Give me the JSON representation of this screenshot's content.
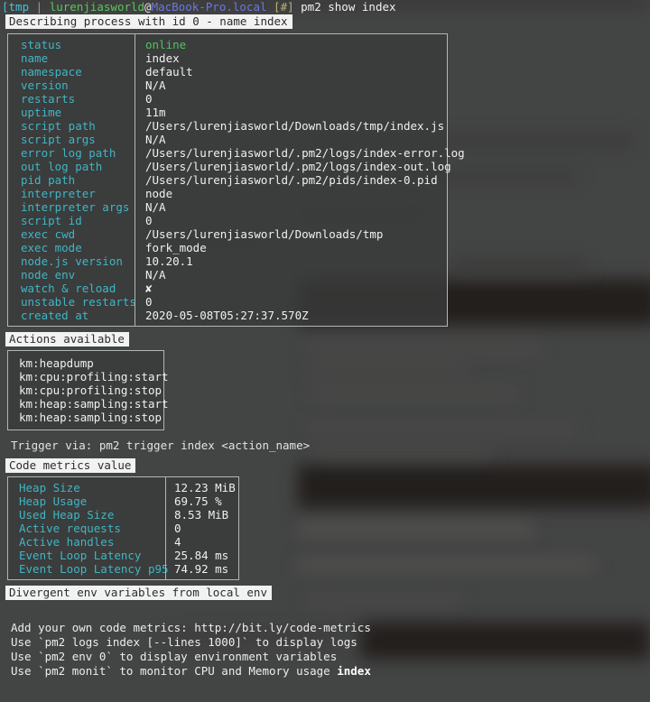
{
  "prompt": {
    "dir": "[tmp",
    "separator": " | ",
    "user": "lurenjiasworld",
    "at": "@",
    "host": "MacBook-Pro.local",
    "marker": " [#] ",
    "command": "pm2 show index"
  },
  "describe": {
    "header": "Describing process with id 0 - name index",
    "rows": [
      {
        "label": "status",
        "value": "online",
        "accent": "#4ec45f"
      },
      {
        "label": "name",
        "value": "index"
      },
      {
        "label": "namespace",
        "value": "default"
      },
      {
        "label": "version",
        "value": "N/A"
      },
      {
        "label": "restarts",
        "value": "0"
      },
      {
        "label": "uptime",
        "value": "11m"
      },
      {
        "label": "script path",
        "value": "/Users/lurenjiasworld/Downloads/tmp/index.js"
      },
      {
        "label": "script args",
        "value": "N/A"
      },
      {
        "label": "error log path",
        "value": "/Users/lurenjiasworld/.pm2/logs/index-error.log"
      },
      {
        "label": "out log path",
        "value": "/Users/lurenjiasworld/.pm2/logs/index-out.log"
      },
      {
        "label": "pid path",
        "value": "/Users/lurenjiasworld/.pm2/pids/index-0.pid"
      },
      {
        "label": "interpreter",
        "value": "node"
      },
      {
        "label": "interpreter args",
        "value": "N/A"
      },
      {
        "label": "script id",
        "value": "0"
      },
      {
        "label": "exec cwd",
        "value": "/Users/lurenjiasworld/Downloads/tmp"
      },
      {
        "label": "exec mode",
        "value": "fork_mode"
      },
      {
        "label": "node.js version",
        "value": "10.20.1"
      },
      {
        "label": "node env",
        "value": "N/A"
      },
      {
        "label": "watch & reload",
        "value": "✘"
      },
      {
        "label": "unstable restarts",
        "value": "0"
      },
      {
        "label": "created at",
        "value": "2020-05-08T05:27:37.570Z"
      }
    ]
  },
  "actions": {
    "header": "Actions available",
    "items": [
      "km:heapdump",
      "km:cpu:profiling:start",
      "km:cpu:profiling:stop",
      "km:heap:sampling:start",
      "km:heap:sampling:stop"
    ],
    "trigger_hint": "Trigger via: pm2 trigger index <action_name>"
  },
  "metrics": {
    "header": "Code metrics value",
    "rows": [
      {
        "label": "Heap Size",
        "value": "12.23 MiB"
      },
      {
        "label": "Heap Usage",
        "value": "69.75 %"
      },
      {
        "label": "Used Heap Size",
        "value": "8.53 MiB"
      },
      {
        "label": "Active requests",
        "value": "0"
      },
      {
        "label": "Active handles",
        "value": "4"
      },
      {
        "label": "Event Loop Latency",
        "value": "25.84 ms"
      },
      {
        "label": "Event Loop Latency p95",
        "value": "74.92 ms"
      }
    ]
  },
  "env": {
    "header": "Divergent env variables from local env"
  },
  "footer": {
    "lines": [
      "Add your own code metrics: http://bit.ly/code-metrics",
      "Use `pm2 logs index [--lines 1000]` to display logs",
      "Use `pm2 env 0` to display environment variables"
    ],
    "last_line_prefix": "Use `pm2 monit` to monitor CPU and Memory usage ",
    "last_line_bold": "index"
  },
  "colors": {
    "label": "#3fb6c4",
    "value": "#f0f0f0",
    "status_online": "#4ec45f",
    "border": "#b2b6b6",
    "terminal_bg": "#3a3b3b",
    "header_invert_bg": "#f2f2f2",
    "header_invert_fg": "#2c2c2c"
  }
}
